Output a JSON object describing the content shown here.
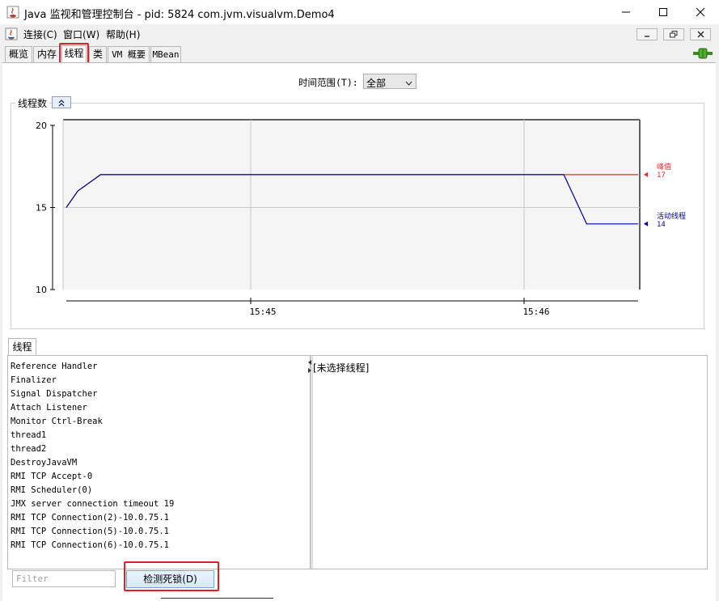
{
  "window": {
    "title": "Java 监视和管理控制台 - pid: 5824 com.jvm.visualvm.Demo4"
  },
  "menu": {
    "items": [
      "连接(C)",
      "窗口(W)",
      "帮助(H)"
    ]
  },
  "tabs": [
    "概览",
    "内存",
    "线程",
    "类",
    "VM 概要",
    "MBean"
  ],
  "active_tab": "线程",
  "time_range": {
    "label": "时间范围(T):",
    "value": "全部"
  },
  "chart_panel": {
    "title": "线程数"
  },
  "chart_data": {
    "type": "line",
    "title": "",
    "xlabel": "",
    "ylabel": "",
    "ylim": [
      10,
      20
    ],
    "yticks": [
      "10",
      "15",
      "20"
    ],
    "xticks": [
      "15:45",
      "15:46"
    ],
    "series": [
      {
        "name": "峰值",
        "color": "#e03030",
        "current": "17",
        "x": [
          0,
          0.02,
          0.06,
          0.87,
          0.91,
          1.0
        ],
        "values": [
          15,
          16,
          17,
          17,
          17,
          17
        ]
      },
      {
        "name": "活动线程",
        "color": "#0000a0",
        "current": "14",
        "x": [
          0,
          0.02,
          0.06,
          0.87,
          0.91,
          1.0
        ],
        "values": [
          15,
          16,
          17,
          17,
          14,
          14
        ]
      }
    ]
  },
  "threads_panel": {
    "tab_label": "线程",
    "threads": [
      "Reference Handler",
      "Finalizer",
      "Signal Dispatcher",
      "Attach Listener",
      "Monitor Ctrl-Break",
      "thread1",
      "thread2",
      "DestroyJavaVM",
      "RMI TCP Accept-0",
      "RMI Scheduler(0)",
      "JMX server connection timeout 19",
      "RMI TCP Connection(2)-10.0.75.1",
      "RMI TCP Connection(5)-10.0.75.1",
      "RMI TCP Connection(6)-10.0.75.1"
    ],
    "detail_placeholder": "[未选择线程]",
    "filter_placeholder": "Filter",
    "detect_deadlock_label": "检测死锁(D)"
  }
}
